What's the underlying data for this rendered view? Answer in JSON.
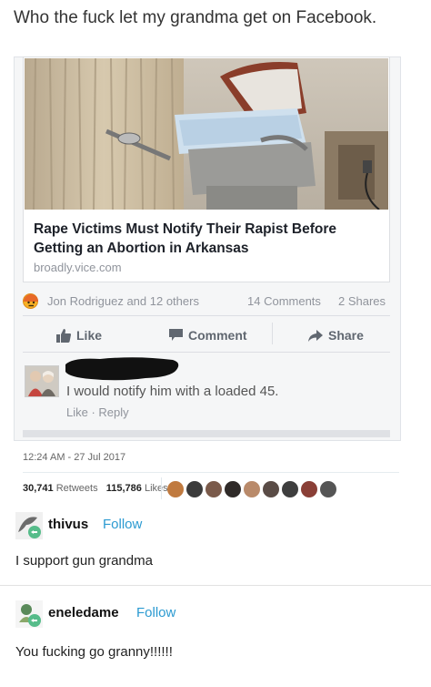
{
  "caption": "Who the fuck let my grandma get on Facebook.",
  "fb": {
    "headline": "Rape Victims Must Notify Their Rapist Before Getting an Abortion in Arkansas",
    "domain": "broadly.vice.com",
    "reactions": "Jon Rodriguez and 12 others",
    "comments_count": "14 Comments",
    "shares_count": "2 Shares",
    "like_label": "Like",
    "comment_label": "Comment",
    "share_label": "Share",
    "comment_text": "I would notify him with a loaded 45.",
    "comment_meta": "Like · Reply"
  },
  "tweet": {
    "timestamp": "12:24 AM - 27 Jul 2017",
    "retweets_num": "30,741",
    "retweets_label": "Retweets",
    "likes_num": "115,786",
    "likes_label": "Likes"
  },
  "replies": [
    {
      "username": "thivus",
      "follow_label": "Follow",
      "text": "I support gun grandma"
    },
    {
      "username": "eneledame",
      "follow_label": "Follow",
      "text": "You fucking go granny!!!!!!"
    }
  ],
  "colors": {
    "accent": "#2b9ad1",
    "reblog_badge": "#56bc8a",
    "facebook_gray": "#606770"
  }
}
